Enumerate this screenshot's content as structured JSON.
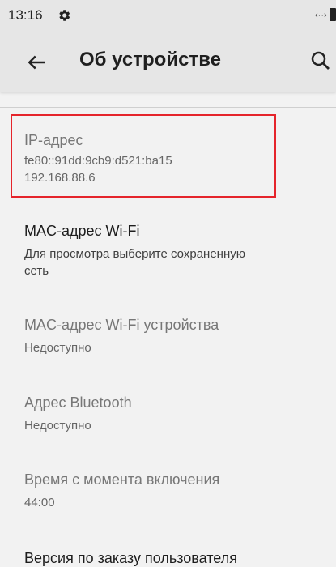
{
  "status_bar": {
    "time": "13:16",
    "icons": [
      "gear-icon",
      "dev-mode-icon",
      "battery-icon"
    ],
    "dev_glyph": "‹··›"
  },
  "app_bar": {
    "title": "Об устройстве",
    "back_icon": "arrow-left-icon",
    "search_icon": "search-icon"
  },
  "items": [
    {
      "title": "IP-адрес",
      "lines": [
        "fe80::91dd:9cb9:d521:ba15",
        "192.168.88.6"
      ],
      "highlighted": true,
      "enabled": false
    },
    {
      "title": "MAC-адрес Wi-Fi",
      "lines": [
        "Для просмотра выберите сохраненную",
        "сеть"
      ],
      "highlighted": false,
      "enabled": true
    },
    {
      "title": "MAC-адрес Wi-Fi устройства",
      "lines": [
        "Недоступно"
      ],
      "highlighted": false,
      "enabled": false
    },
    {
      "title": "Адрес Bluetooth",
      "lines": [
        "Недоступно"
      ],
      "highlighted": false,
      "enabled": false
    },
    {
      "title": "Время с момента включения",
      "lines": [
        "44:00"
      ],
      "highlighted": false,
      "enabled": false
    },
    {
      "title": "Версия по заказу пользователя",
      "lines": [],
      "highlighted": false,
      "enabled": true
    }
  ],
  "colors": {
    "background": "#f2f2f2",
    "app_bar": "#e6e6e6",
    "highlight_border": "#e5242b"
  }
}
